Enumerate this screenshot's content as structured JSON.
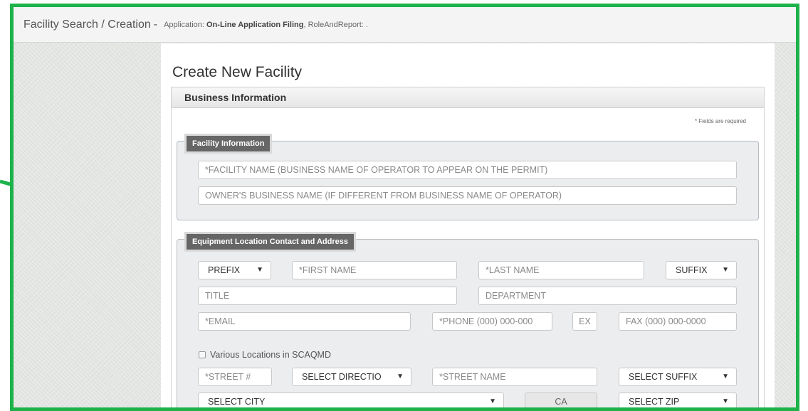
{
  "header": {
    "title": "Facility Search / Creation",
    "sep": "-",
    "app_label": "Application:",
    "app_name": "On-Line Application Filing",
    "role_text": ", RoleAndReport: ."
  },
  "page_title": "Create New Facility",
  "business_section": {
    "title": "Business Information",
    "required_note": "* Fields are required"
  },
  "facility_info": {
    "legend": "Facility Information",
    "facility_name_placeholder": "*FACILITY NAME (BUSINESS NAME OF OPERATOR TO APPEAR ON THE PERMIT)",
    "owner_name_placeholder": "OWNER'S BUSINESS NAME (IF DIFFERENT FROM BUSINESS NAME OF OPERATOR)"
  },
  "equipment_location": {
    "legend": "Equipment Location Contact and Address",
    "prefix": "PREFIX",
    "first_name": "*FIRST NAME",
    "last_name": "*LAST NAME",
    "suffix": "SUFFIX",
    "title": "TITLE",
    "department": "DEPARTMENT",
    "email": "*EMAIL",
    "phone": "*PHONE (000) 000-000",
    "ext": "EX",
    "fax": "FAX (000) 000-0000",
    "various_locations": "Various Locations in SCAQMD",
    "street_number": "*STREET #",
    "direction": "SELECT DIRECTIO",
    "street_name": "*STREET NAME",
    "street_suffix": "SELECT SUFFIX",
    "city": "SELECT CITY",
    "state": "CA",
    "zip": "SELECT ZIP"
  },
  "colors": {
    "frame_border": "#1db24a",
    "annotation_arrow": "#1db24a",
    "legend_bg": "#666666"
  },
  "icons": {
    "dropdown": "caret-down-icon",
    "annotation": "green-arrow-icon"
  }
}
